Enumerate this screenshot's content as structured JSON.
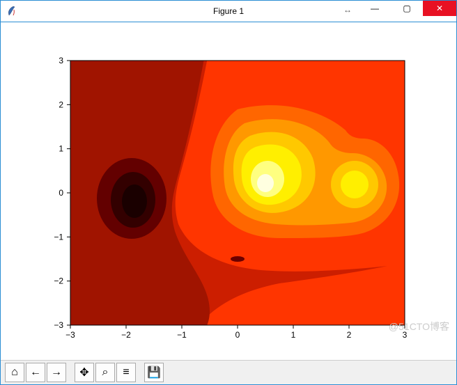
{
  "window": {
    "title": "Figure 1",
    "resize_glyph": "↔",
    "minimize_glyph": "—",
    "maximize_glyph": "▢",
    "close_glyph": "✕"
  },
  "toolbar": {
    "home": "⌂",
    "back": "←",
    "forward": "→",
    "pan": "✥",
    "zoom": "⌕",
    "configure": "≡",
    "save": "💾"
  },
  "watermark": "@51CTO博客",
  "chart_data": {
    "type": "heatmap",
    "title": "",
    "xlabel": "",
    "ylabel": "",
    "xlim": [
      -3,
      3
    ],
    "ylim": [
      -3,
      3
    ],
    "xticks": [
      -3,
      -2,
      -1,
      0,
      1,
      2,
      3
    ],
    "yticks": [
      -3,
      -2,
      -1,
      0,
      1,
      2,
      3
    ],
    "colormap": "hot",
    "description": "Filled contour of a scalar field: deep minimum near (-1.9, -0.1), main high peak near (0, 0.3), secondary high peak near (1.6, 0.2), small local dip near (0, -1.5)",
    "features": [
      {
        "kind": "min",
        "x": -1.9,
        "y": -0.1,
        "approx_value": -1.0
      },
      {
        "kind": "max",
        "x": 0.0,
        "y": 0.3,
        "approx_value": 1.0
      },
      {
        "kind": "max",
        "x": 1.6,
        "y": 0.2,
        "approx_value": 0.8
      },
      {
        "kind": "dip",
        "x": 0.0,
        "y": -1.5,
        "approx_value": 0.1
      }
    ],
    "color_levels": [
      "#cc1e00",
      "#ff3500",
      "#ff6600",
      "#ff9800",
      "#ffc800",
      "#ffef00",
      "#ffff80",
      "#ffffe0",
      "#a01400",
      "#630000",
      "#330000",
      "#1a0000"
    ]
  }
}
